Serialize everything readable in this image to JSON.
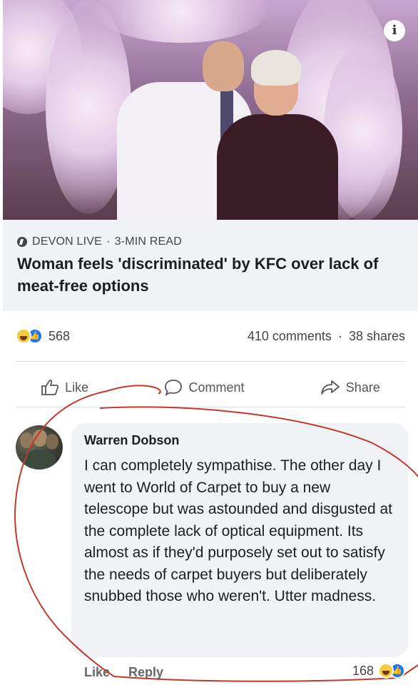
{
  "article": {
    "source": "DEVON LIVE",
    "read_time": "3-MIN READ",
    "separator": "·",
    "headline": "Woman feels 'discriminated' by KFC over lack of meat-free options"
  },
  "post_stats": {
    "reaction_count": "568",
    "comments": "410 comments",
    "dot": "·",
    "shares": "38 shares"
  },
  "actions": {
    "like": "Like",
    "comment": "Comment",
    "share": "Share"
  },
  "comment": {
    "author": "Warren Dobson",
    "text": "I can completely sympathise. The other day I went to World of Carpet to buy a new telescope but was astounded and disgusted at the complete lack of optical equipment. Its almost as if they'd purposely set out to satisfy the needs of carpet buyers but deliberately snubbed those who weren't. Utter madness.",
    "like_label": "Like",
    "reply_label": "Reply",
    "reaction_count": "168"
  },
  "icons": {
    "info": "info-icon",
    "source": "news-source-icon",
    "haha": "haha-reaction-icon",
    "like": "like-reaction-icon",
    "thumb": "thumbs-up-icon",
    "comment": "comment-bubble-icon",
    "share": "share-arrow-icon"
  },
  "colors": {
    "link_bg": "#f0f2f5",
    "like_blue": "#1877f2",
    "annotation_red": "#c0392b"
  }
}
